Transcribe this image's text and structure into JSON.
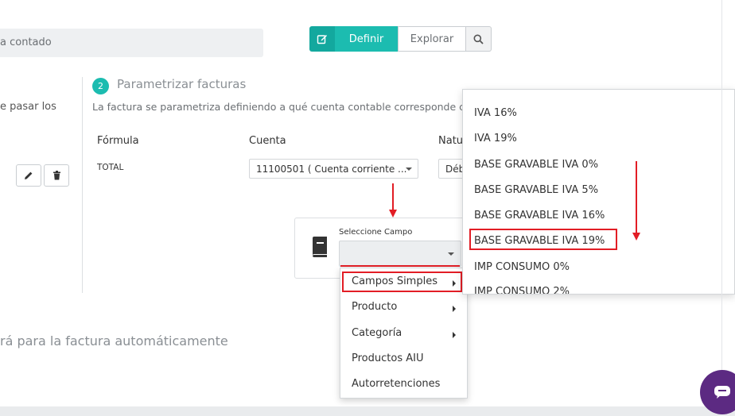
{
  "top": {
    "search_fragment": "a contado",
    "btn_definir": "Definir",
    "btn_explorar": "Explorar"
  },
  "left": {
    "text_fragment": "e pasar los"
  },
  "step": {
    "number": "2",
    "title": "Parametrizar facturas",
    "description": "La factura se parametriza definiendo a qué cuenta contable corresponde cada c"
  },
  "table": {
    "headers": [
      "Fórmula",
      "Cuenta",
      "Natu"
    ],
    "row": {
      "formula": "TOTAL",
      "cuenta": "11100501 ( Cuenta corriente ...",
      "naturaleza": "Déb"
    }
  },
  "field": {
    "label": "Seleccione Campo"
  },
  "menu": {
    "items": [
      {
        "label": "Campos Simples",
        "has_sub": true
      },
      {
        "label": "Producto",
        "has_sub": true
      },
      {
        "label": "Categoría",
        "has_sub": true
      },
      {
        "label": "Productos AIU",
        "has_sub": false
      },
      {
        "label": "Autorretenciones",
        "has_sub": false
      }
    ]
  },
  "submenu": {
    "items": [
      "IVA 16%",
      "IVA 19%",
      "BASE GRAVABLE IVA 0%",
      "BASE GRAVABLE IVA 5%",
      "BASE GRAVABLE IVA 16%",
      "BASE GRAVABLE IVA 19%",
      "IMP CONSUMO 0%",
      "IMP CONSUMO 2%"
    ]
  },
  "bottom": {
    "text_fragment": "rá para la factura automáticamente"
  },
  "colors": {
    "accent": "#1cbcb0",
    "accent_dark": "#13a89e",
    "highlight": "#e21d25",
    "chat": "#5c2a82"
  }
}
